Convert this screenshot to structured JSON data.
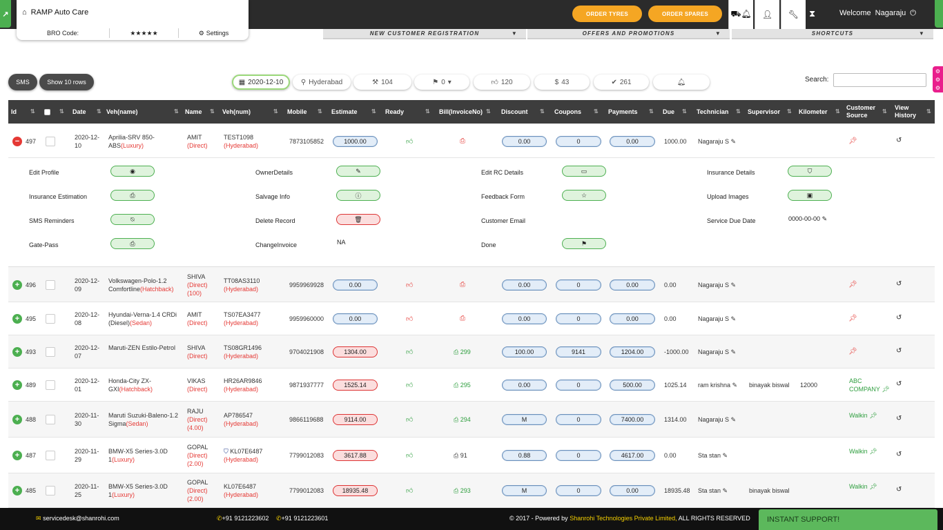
{
  "app": {
    "title": "RAMP Auto Care",
    "bro_code_label": "BRO Code:",
    "stars": "★★★★★",
    "settings_label": "Settings"
  },
  "header": {
    "order_tyres": "ORDER TYRES",
    "order_spares": "ORDER SPARES",
    "welcome_label": "Welcome",
    "user_name": "Nagaraju"
  },
  "dropdowns": {
    "new_customer": "NEW CUSTOMER REGISTRATION",
    "offers": "OFFERS AND PROMOTIONS",
    "shortcuts": "SHORTCUTS"
  },
  "toolbar": {
    "sms": "SMS",
    "show_rows": "Show 10 rows",
    "date": "2020-12-10",
    "city": "Hyderabad",
    "tools_count": "104",
    "flag_count": "0",
    "likes": "120",
    "dollars": "43",
    "checks": "261",
    "search_label": "Search:",
    "search_value": ""
  },
  "columns": [
    "Id",
    "Date",
    "Veh(name)",
    "Name",
    "Veh(num)",
    "Mobile",
    "Estimate",
    "Ready",
    "Bill(InvoiceNo)",
    "Discount",
    "Coupons",
    "Payments",
    "Due",
    "Technician",
    "Supervisor",
    "Kilometer",
    "Customer Source",
    "View History"
  ],
  "rows": [
    {
      "id": "497",
      "date1": "2020-12-",
      "date2": "10",
      "veh1": "Aprilia-SRV 850-",
      "veh2": "ABS",
      "veh_type": "(Luxury)",
      "name": "AMIT",
      "src": "(Direct)",
      "extra": "",
      "num": "TEST1098",
      "num_city": "(Hyderabad)",
      "mobile": "7873105852",
      "estimate": "1000.00",
      "bill": "",
      "discount": "0.00",
      "coupons": "0",
      "payments": "0.00",
      "due": "1000.00",
      "technician": "Nagaraju S",
      "supervisor": "",
      "km": "",
      "cust_source": "",
      "expanded": true
    },
    {
      "id": "496",
      "date1": "2020-12-",
      "date2": "09",
      "veh1": "Volkswagen-Polo-1.2",
      "veh2": "Comfortline",
      "veh_type": "(Hatchback)",
      "name": "SHIVA",
      "src": "(Direct)",
      "extra": "(100)",
      "num": "TT08AS3110",
      "num_city": "(Hyderabad)",
      "mobile": "9959969928",
      "estimate": "0.00",
      "bill": "",
      "discount": "0.00",
      "coupons": "0",
      "payments": "0.00",
      "due": "0.00",
      "technician": "Nagaraju S",
      "supervisor": "",
      "km": "",
      "cust_source": ""
    },
    {
      "id": "495",
      "date1": "2020-12-",
      "date2": "08",
      "veh1": "Hyundai-Verna-1.4 CRDi",
      "veh2": "(Diesel)",
      "veh_type": "(Sedan)",
      "name": "AMIT",
      "src": "(Direct)",
      "extra": "",
      "num": "TS07EA3477",
      "num_city": "(Hyderabad)",
      "mobile": "9959960000",
      "estimate": "0.00",
      "bill": "",
      "discount": "0.00",
      "coupons": "0",
      "payments": "0.00",
      "due": "0.00",
      "technician": "Nagaraju S",
      "supervisor": "",
      "km": "",
      "cust_source": ""
    },
    {
      "id": "493",
      "date1": "2020-12-",
      "date2": "07",
      "veh1": "Maruti-ZEN Estilo-Petrol",
      "veh2": "",
      "veh_type": "",
      "name": "SHIVA",
      "src": "(Direct)",
      "extra": "",
      "num": "TS08GR1496",
      "num_city": "(Hyderabad)",
      "mobile": "9704021908",
      "estimate": "1304.00",
      "bill": "299",
      "discount": "100.00",
      "coupons": "9141",
      "payments": "1204.00",
      "due": "-1000.00",
      "technician": "Nagaraju S",
      "supervisor": "",
      "km": "",
      "cust_source": ""
    },
    {
      "id": "489",
      "date1": "2020-12-",
      "date2": "01",
      "veh1": "Honda-City ZX-",
      "veh2": "GXI",
      "veh_type": "(Hatchback)",
      "name": "VIKAS",
      "src": "(Direct)",
      "extra": "",
      "num": "HR26AR9846",
      "num_city": "(Hyderabad)",
      "mobile": "9871937777",
      "estimate": "1525.14",
      "bill": "295",
      "discount": "0.00",
      "coupons": "0",
      "payments": "500.00",
      "due": "1025.14",
      "technician": "ram krishna",
      "supervisor": "binayak biswal",
      "km": "12000",
      "cust_source": "ABC COMPANY"
    },
    {
      "id": "488",
      "date1": "2020-11-",
      "date2": "30",
      "veh1": "Maruti Suzuki-Baleno-1.2",
      "veh2": "Sigma",
      "veh_type": "(Sedan)",
      "name": "RAJU",
      "src": "(Direct)",
      "extra": "(4.00)",
      "num": "AP786547",
      "num_city": "(Hyderabad)",
      "mobile": "9866119688",
      "estimate": "9114.00",
      "bill": "294",
      "discount": "M",
      "coupons": "0",
      "payments": "7400.00",
      "due": "1314.00",
      "technician": "Nagaraju S",
      "supervisor": "",
      "km": "",
      "cust_source": "Walkin"
    },
    {
      "id": "487",
      "date1": "2020-11-",
      "date2": "29",
      "veh1": "BMW-X5 Series-3.0D",
      "veh2": "1",
      "veh_type": "(Luxury)",
      "name": "GOPAL",
      "src": "(Direct)",
      "extra": "(2.00)",
      "num": "KL07E6487",
      "num_city": "(Hyderabad)",
      "mobile": "7799012083",
      "estimate": "3617.88",
      "bill": "91",
      "discount": "0.88",
      "coupons": "0",
      "payments": "4617.00",
      "due": "0.00",
      "technician": "Sta stan",
      "supervisor": "",
      "km": "",
      "cust_source": "Walkin"
    },
    {
      "id": "485",
      "date1": "2020-11-",
      "date2": "25",
      "veh1": "BMW-X5 Series-3.0D",
      "veh2": "1",
      "veh_type": "(Luxury)",
      "name": "GOPAL",
      "src": "(Direct)",
      "extra": "(2.00)",
      "num": "KL07E6487",
      "num_city": "(Hyderabad)",
      "mobile": "7799012083",
      "estimate": "18935.48",
      "bill": "293",
      "discount": "M",
      "coupons": "0",
      "payments": "0.00",
      "due": "18935.48",
      "technician": "Sta stan",
      "supervisor": "binayak biswal",
      "km": "",
      "cust_source": "Walkin"
    }
  ],
  "detail": {
    "edit_profile": "Edit Profile",
    "owner_details": "OwnerDetails",
    "edit_rc": "Edit RC Details",
    "insurance_details": "Insurance Details",
    "insurance_estimation": "Insurance Estimation",
    "salvage_info": "Salvage Info",
    "feedback_form": "Feedback Form",
    "upload_images": "Upload Images",
    "sms_reminders": "SMS Reminders",
    "delete_record": "Delete Record",
    "customer_email": "Customer Email",
    "service_due_date": "Service Due Date",
    "service_due_value": "0000-00-00",
    "gate_pass": "Gate-Pass",
    "change_invoice": "ChangeInvoice",
    "change_invoice_value": "NA",
    "done": "Done"
  },
  "footer": {
    "email": "servicedesk@shanrohi.com",
    "phone1": "+91 9121223602",
    "phone2": "+91 9121223601",
    "copyright_prefix": "© 2017 - Powered by",
    "company": "Shanrohi Technologies Private Limited,",
    "rights": "ALL RIGHTS RESERVED",
    "instant_support": "INSTANT SUPPORT!"
  },
  "colors": {
    "accent_green": "#4caf50",
    "orange": "#f5a623",
    "header_dark": "#2b2b2b",
    "red": "#e53935",
    "pink": "#e91e8c"
  }
}
